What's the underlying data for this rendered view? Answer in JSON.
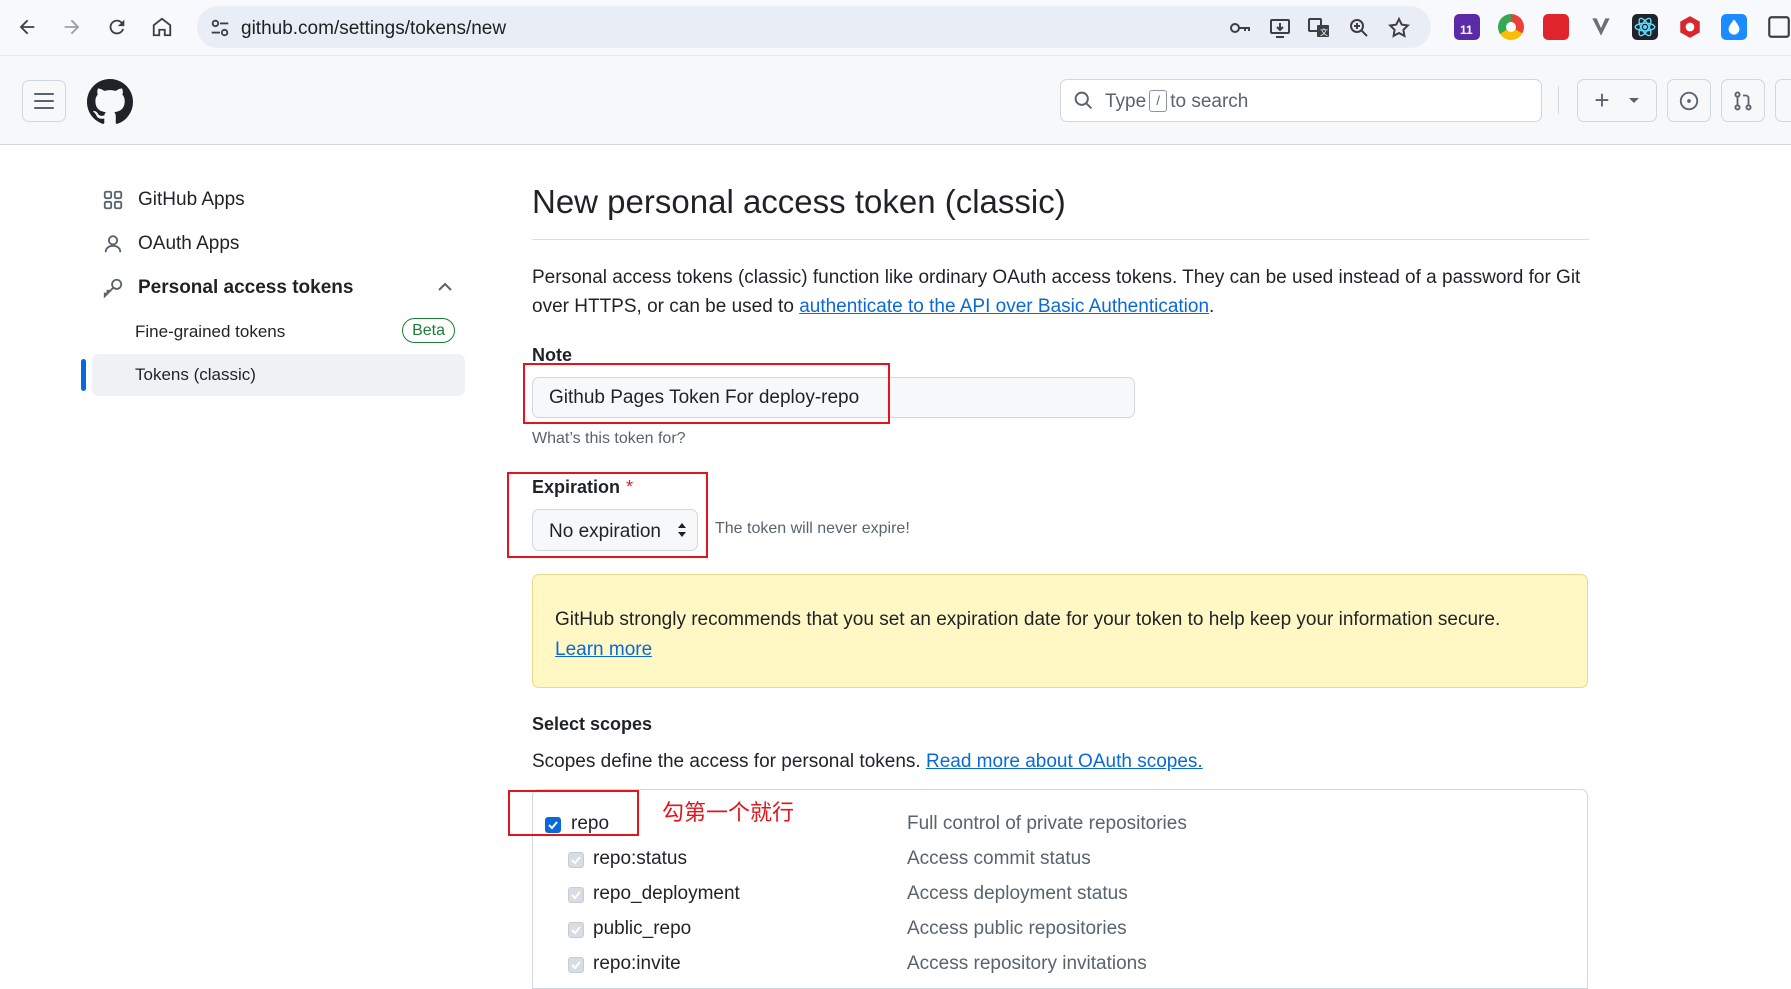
{
  "browser": {
    "url": "github.com/settings/tokens/new",
    "extension_badge": "11",
    "icons": [
      "back-icon",
      "forward-icon",
      "reload-icon",
      "home-icon",
      "site-settings-icon",
      "password-key-icon",
      "install-app-icon",
      "translate-icon",
      "zoom-icon",
      "bookmark-star-icon"
    ]
  },
  "header": {
    "search_prefix": "Type",
    "search_key": "/",
    "search_suffix": "to search",
    "new_button": "+"
  },
  "sidebar": {
    "items": [
      {
        "label": "GitHub Apps",
        "icon": "apps-grid-icon"
      },
      {
        "label": "OAuth Apps",
        "icon": "person-icon"
      },
      {
        "label": "Personal access tokens",
        "icon": "key-icon"
      }
    ],
    "sub_items": [
      {
        "label": "Fine-grained tokens",
        "badge": "Beta"
      },
      {
        "label": "Tokens (classic)"
      }
    ]
  },
  "main": {
    "title": "New personal access token (classic)",
    "intro_text": "Personal access tokens (classic) function like ordinary OAuth access tokens. They can be used instead of a password for Git over HTTPS, or can be used to",
    "intro_link": "authenticate to the API over Basic Authentication",
    "intro_end": ".",
    "note_label": "Note",
    "note_value": "Github Pages Token For deploy-repo",
    "note_hint": "What’s this token for?",
    "expiration_label": "Expiration",
    "expiration_required": "*",
    "expiration_value": "No expiration",
    "expiration_hint": "The token will never expire!",
    "warning_text": "GitHub strongly recommends that you set an expiration date for your token to help keep your information secure.",
    "warning_link": "Learn more",
    "scopes_title": "Select scopes",
    "scopes_text": "Scopes define the access for personal tokens.",
    "scopes_link": "Read more about OAuth scopes.",
    "scopes": [
      {
        "name": "repo",
        "desc": "Full control of private repositories",
        "checked": true
      },
      {
        "name": "repo:status",
        "desc": "Access commit status",
        "checked": true
      },
      {
        "name": "repo_deployment",
        "desc": "Access deployment status",
        "checked": true
      },
      {
        "name": "public_repo",
        "desc": "Access public repositories",
        "checked": true
      },
      {
        "name": "repo:invite",
        "desc": "Access repository invitations",
        "checked": true
      }
    ]
  },
  "annotation": {
    "note": "勾第一个就行",
    "color": "#e3141a"
  }
}
